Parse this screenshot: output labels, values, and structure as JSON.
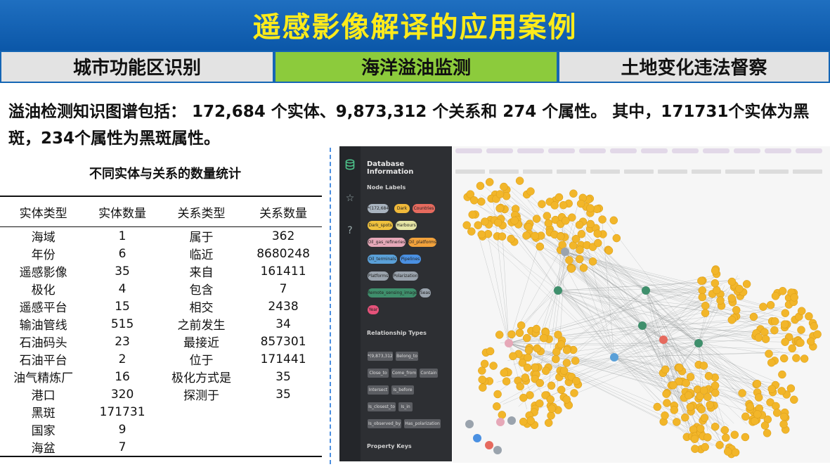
{
  "title": "遥感影像解译的应用案例",
  "tabs": [
    {
      "label": "城市功能区识别",
      "active": false
    },
    {
      "label": "海洋溢油监测",
      "active": true
    },
    {
      "label": "土地变化违法督察",
      "active": false
    }
  ],
  "summary": "溢油检测知识图谱包括： 172,684 个实体、9,873,312 个关系和 274 个属性。 其中，171731个实体为黑斑，234个属性为黑斑属性。",
  "table": {
    "title": "不同实体与关系的数量统计",
    "headers": [
      "实体类型",
      "实体数量",
      "关系类型",
      "关系数量"
    ],
    "rows": [
      [
        "海域",
        "1",
        "属于",
        "362"
      ],
      [
        "年份",
        "6",
        "临近",
        "8680248"
      ],
      [
        "遥感影像",
        "35",
        "来自",
        "161411"
      ],
      [
        "极化",
        "4",
        "包含",
        "7"
      ],
      [
        "遥感平台",
        "15",
        "相交",
        "2438"
      ],
      [
        "输油管线",
        "515",
        "之前发生",
        "34"
      ],
      [
        "石油码头",
        "23",
        "最接近",
        "857301"
      ],
      [
        "石油平台",
        "2",
        "位于",
        "171441"
      ],
      [
        "油气精炼厂",
        "16",
        "极化方式是",
        "35"
      ],
      [
        "港口",
        "320",
        "探测于",
        "35"
      ],
      [
        "黑斑",
        "171731",
        "",
        ""
      ],
      [
        "国家",
        "9",
        "",
        ""
      ],
      [
        "海盆",
        "7",
        "",
        ""
      ]
    ]
  },
  "database_panel": {
    "header": "Database Information",
    "node_labels_heading": "Node Labels",
    "relationship_types_heading": "Relationship Types",
    "property_keys_heading": "Property Keys",
    "node_labels": [
      {
        "text": "*(172,684)",
        "color": "#a9b4c0"
      },
      {
        "text": "Dark",
        "color": "#f0b93a"
      },
      {
        "text": "Countries",
        "color": "#e66a5e"
      },
      {
        "text": "Dark_spots",
        "color": "#f0c23e"
      },
      {
        "text": "Harbours",
        "color": "#e6e6a6"
      },
      {
        "text": "Oil_gas_refineries",
        "color": "#e6a8b8"
      },
      {
        "text": "Oil_platforms",
        "color": "#f2a23c"
      },
      {
        "text": "Oil_terminals",
        "color": "#5aa0d8"
      },
      {
        "text": "Pipelines",
        "color": "#4a90e2"
      },
      {
        "text": "Platforms",
        "color": "#9aa3ad"
      },
      {
        "text": "Polarization",
        "color": "#9aa3ad"
      },
      {
        "text": "Remote_sensing_image",
        "color": "#3f8f6c"
      },
      {
        "text": "Seas",
        "color": "#9aa3ad"
      },
      {
        "text": "Year",
        "color": "#e6527a"
      }
    ],
    "relationship_types": [
      "*(9,873,312)",
      "Belong_to",
      "Close_to",
      "Come_from",
      "Contain",
      "Intersect",
      "Is_before",
      "Is_closest_to",
      "Is_in",
      "Is_observed_by",
      "Has_polarization"
    ],
    "icons": {
      "database": "database-icon",
      "favorites": "star-icon",
      "help": "help-icon"
    }
  },
  "graph": {
    "node_color": "#f2b62a",
    "edge_color": "#8c9090",
    "clusters_count": 8
  }
}
